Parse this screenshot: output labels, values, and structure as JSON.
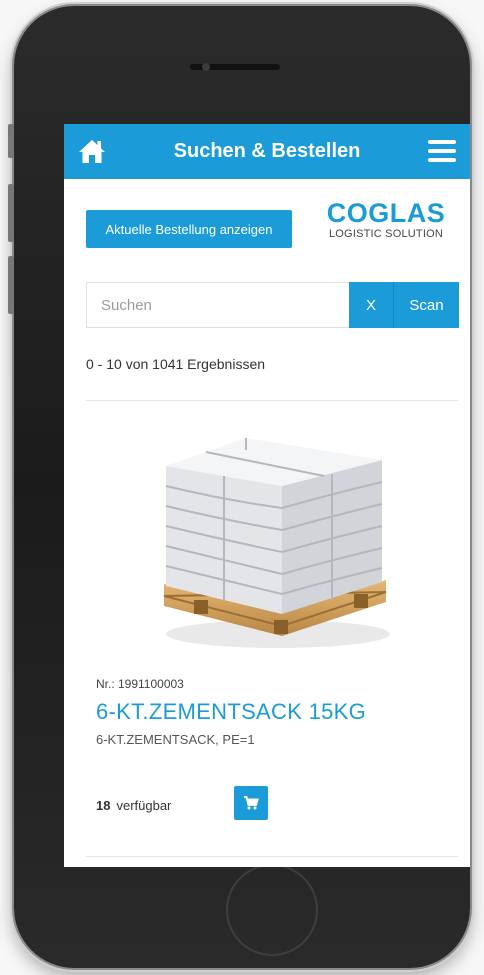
{
  "header": {
    "title": "Suchen & Bestellen",
    "home_icon": "home-icon",
    "menu_icon": "hamburger-menu-icon"
  },
  "actions": {
    "current_order_label": "Aktuelle Bestellung anzeigen"
  },
  "logo": {
    "name": "COGLAS",
    "tagline": "LOGISTIC SOLUTION"
  },
  "search": {
    "placeholder": "Suchen",
    "value": "",
    "clear_label": "X",
    "scan_label": "Scan"
  },
  "results": {
    "summary": "0 - 10 von 1041 Ergebnissen"
  },
  "products": [
    {
      "number": "Nr.: 1991100003",
      "title": "6-KT.ZEMENTSACK 15KG",
      "description": "6-KT.ZEMENTSACK, PE=1",
      "available_count": "18",
      "available_label": "verfügbar",
      "cart_icon": "cart-icon"
    }
  ],
  "colors": {
    "accent": "#1b9bd7",
    "background": "#ffffff"
  }
}
